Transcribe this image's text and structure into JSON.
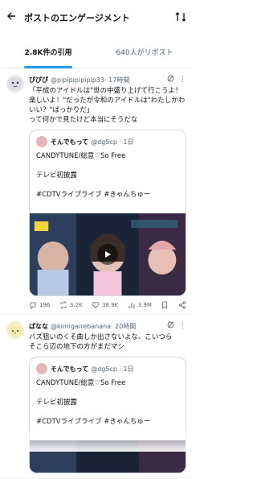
{
  "header": {
    "title": "ポストのエンゲージメント",
    "back_icon": "arrow-left-icon",
    "sort_icon": "sort-arrows-icon"
  },
  "tabs": [
    {
      "label": "2.8K件の引用",
      "active": true
    },
    {
      "label": "640人がリポスト",
      "active": false
    }
  ],
  "posts": [
    {
      "name": "ぴぴぴ",
      "handle": "@pipipipipipip33",
      "time": "· 17時間",
      "text": "「平成のアイドルは\"世の中盛り上げて行こうよ！楽しいよ！\"だったが令和のアイドルは\"わたしかわいい？\"ばっかりだ」\nって何かで見たけど本当にそうだな",
      "quote": {
        "name": "そんでもって",
        "handle": "@dg5cp · 1日",
        "lines": [
          "CANDYTUNE/総意♡So Free",
          "テレビ初披露",
          "#CDTVライブライブ #きゃんちゅー"
        ]
      },
      "stats": {
        "replies": "196",
        "reposts": "3.2K",
        "likes": "38.9K",
        "views": "3.9M"
      }
    },
    {
      "name": "ぱなな",
      "handle": "@kimigairebanana",
      "time": "· 20時間",
      "text": "バズ狙いのくそ曲しか出さないよな、こいつら\nそこら辺の地下の方がまだマシ",
      "quote": {
        "name": "そんでもって",
        "handle": "@dg5cp · 1日",
        "lines": [
          "CANDYTUNE/総意♡So Free",
          "テレビ初披露",
          "#CDTVライブライブ #きゃんちゅー"
        ]
      }
    }
  ],
  "colors": {
    "accent": "#1d9bf0",
    "muted": "#536471"
  }
}
